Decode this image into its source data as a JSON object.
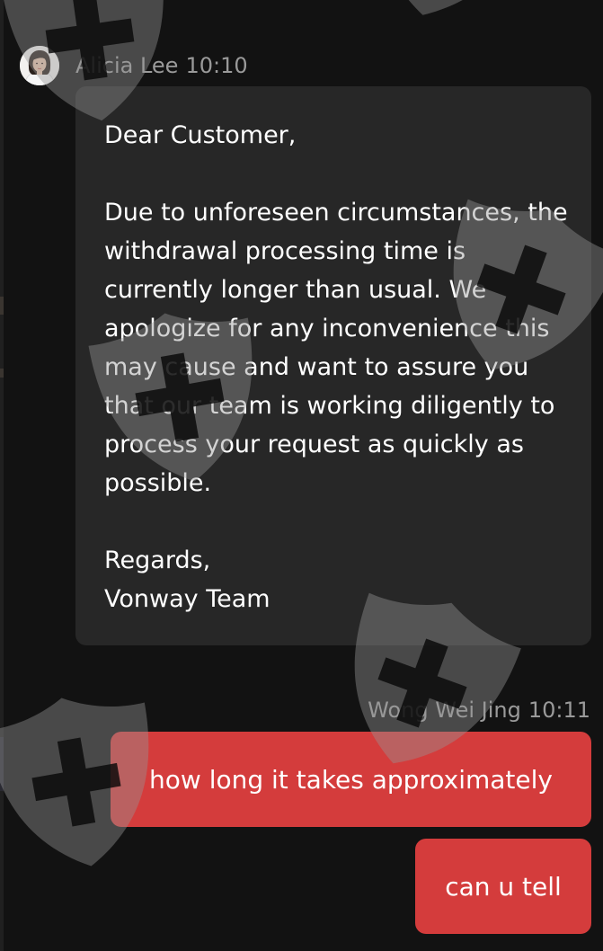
{
  "incoming": {
    "sender": "Alicia Lee",
    "time": "10:10",
    "greeting": "Dear Customer,",
    "body": "Due to unforeseen circumstances, the withdrawal processing time is currently longer than usual. We apologize for any inconvenience this may cause and want to assure you that our team is working diligently to process your request as quickly as possible.",
    "closing": "Regards,",
    "signature": "Vonway Team"
  },
  "outgoing": {
    "sender": "Wong Wei Jing",
    "time": "10:11",
    "messages": [
      "how long it takes approximately",
      "can u tell"
    ]
  },
  "colors": {
    "background": "#121212",
    "incoming_bubble": "#272727",
    "outgoing_bubble": "#d43c3c",
    "meta_text": "#9a9a9a"
  },
  "icons": {
    "watermark": "shield-plus-icon",
    "avatar": "user-avatar"
  }
}
